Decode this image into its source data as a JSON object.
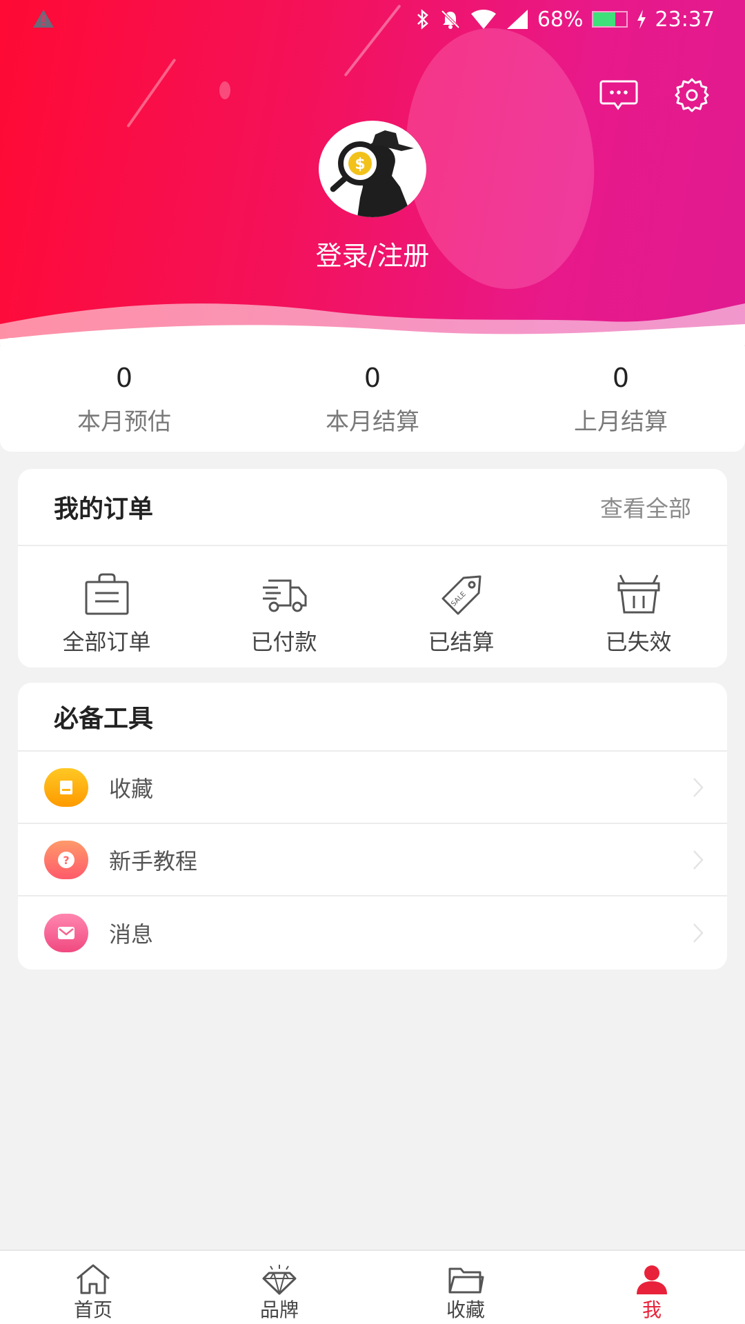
{
  "status_bar": {
    "battery_percent": "68%",
    "time": "23:37",
    "icons": [
      "warning-icon",
      "bluetooth-icon",
      "mute-icon",
      "wifi-icon",
      "signal-icon",
      "battery-icon",
      "charging-icon"
    ]
  },
  "header": {
    "login_text": "登录/注册",
    "icons": [
      "message-icon",
      "settings-icon"
    ],
    "gradient": [
      "#ff0a34",
      "#e01a90"
    ]
  },
  "stats": [
    {
      "value": "0",
      "label": "本月预估"
    },
    {
      "value": "0",
      "label": "本月结算"
    },
    {
      "value": "0",
      "label": "上月结算"
    }
  ],
  "orders": {
    "title": "我的订单",
    "view_all": "查看全部",
    "items": [
      {
        "label": "全部订单",
        "icon": "shopping-bag-icon"
      },
      {
        "label": "已付款",
        "icon": "delivery-truck-icon"
      },
      {
        "label": "已结算",
        "icon": "sale-tag-icon"
      },
      {
        "label": "已失效",
        "icon": "basket-icon"
      }
    ]
  },
  "tools": {
    "title": "必备工具",
    "items": [
      {
        "label": "收藏",
        "icon": "bookmark-icon",
        "color": "#ffb30f"
      },
      {
        "label": "新手教程",
        "icon": "help-icon",
        "color": "#ff7a6a"
      },
      {
        "label": "消息",
        "icon": "mail-icon",
        "color": "#f5658f"
      }
    ]
  },
  "bottom_nav": {
    "active_color": "#e8223a",
    "items": [
      {
        "label": "首页",
        "icon": "home-icon"
      },
      {
        "label": "品牌",
        "icon": "diamond-icon"
      },
      {
        "label": "收藏",
        "icon": "folder-icon"
      },
      {
        "label": "我",
        "icon": "user-icon"
      }
    ]
  }
}
